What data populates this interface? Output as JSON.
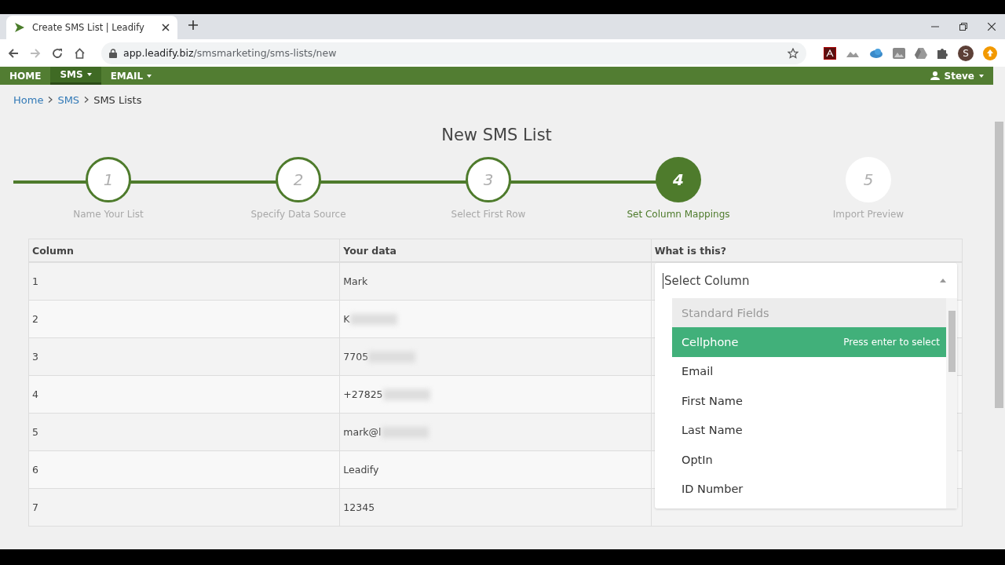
{
  "browser": {
    "tab_title": "Create SMS List | Leadify",
    "url_host": "app.leadify.biz",
    "url_path": "/smsmarketing/sms-lists/new",
    "profile_initial": "S"
  },
  "nav": {
    "items": [
      {
        "label": "HOME",
        "selected": false,
        "dropdown": false
      },
      {
        "label": "SMS",
        "selected": true,
        "dropdown": true
      },
      {
        "label": "EMAIL",
        "selected": false,
        "dropdown": true
      }
    ],
    "user": "Steve"
  },
  "breadcrumb": [
    "Home",
    "SMS",
    "SMS Lists"
  ],
  "title": "New SMS List",
  "steps": [
    {
      "number": "1",
      "label": "Name Your List",
      "kind": "done"
    },
    {
      "number": "2",
      "label": "Specify Data Source",
      "kind": "done"
    },
    {
      "number": "3",
      "label": "Select First Row",
      "kind": "done"
    },
    {
      "number": "4",
      "label": "Set Column Mappings",
      "kind": "current"
    },
    {
      "number": "5",
      "label": "Import Preview",
      "kind": "pending"
    }
  ],
  "table": {
    "columns": [
      "Column",
      "Your data",
      "What is this?"
    ],
    "rows": [
      {
        "column": "1",
        "data": "Mark",
        "redacted": false
      },
      {
        "column": "2",
        "data": "K",
        "redacted": true
      },
      {
        "column": "3",
        "data": "7705",
        "redacted": true
      },
      {
        "column": "4",
        "data": "+27825",
        "redacted": true
      },
      {
        "column": "5",
        "data": "mark@l",
        "redacted": true
      },
      {
        "column": "6",
        "data": "Leadify",
        "redacted": false
      },
      {
        "column": "7",
        "data": "12345",
        "redacted": false
      }
    ]
  },
  "dropdown": {
    "placeholder": "Select Column",
    "group": "Standard Fields",
    "hint": "Press enter to select",
    "options": [
      {
        "label": "Cellphone",
        "selected": true
      },
      {
        "label": "Email",
        "selected": false
      },
      {
        "label": "First Name",
        "selected": false
      },
      {
        "label": "Last Name",
        "selected": false
      },
      {
        "label": "OptIn",
        "selected": false
      },
      {
        "label": "ID Number",
        "selected": false
      }
    ]
  }
}
